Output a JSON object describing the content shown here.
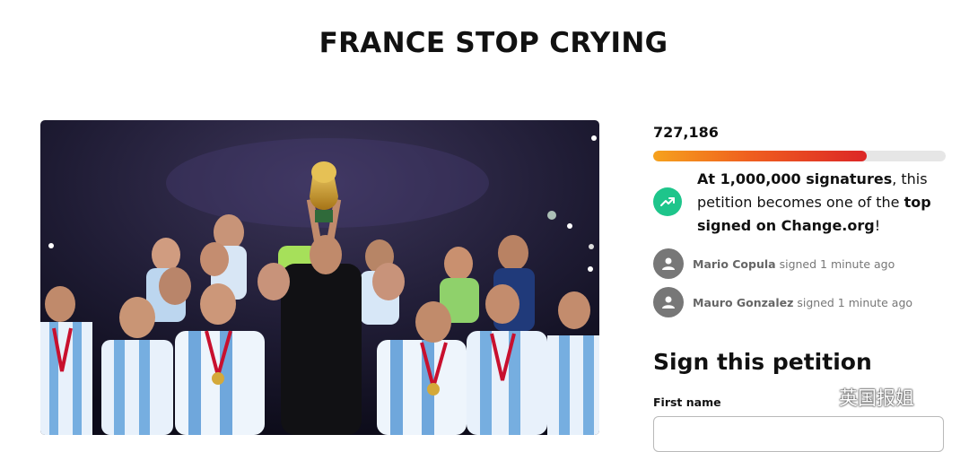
{
  "petition": {
    "title": "FRANCE STOP CRYING",
    "signature_count": "727,186",
    "progress_fraction": 0.73,
    "goal": {
      "bold1": "At 1,000,000 signatures",
      "plain1": ", this petition becomes one of the ",
      "bold2": "top signed on Change.org",
      "plain2": "!"
    }
  },
  "recent_signers": [
    {
      "name": "Mario Copula",
      "action": "signed 1 minute ago"
    },
    {
      "name": "Mauro Gonzalez",
      "action": "signed 1 minute ago"
    }
  ],
  "sign_form": {
    "heading": "Sign this petition",
    "first_name_label": "First name",
    "first_name_value": ""
  },
  "watermark": {
    "text": "英国报姐"
  },
  "colors": {
    "accent_green": "#1ec58b",
    "progress_start": "#f6a21d",
    "progress_end": "#dc2626"
  },
  "icons": [
    "trending-up-icon",
    "user-avatar-icon",
    "wechat-icon"
  ]
}
